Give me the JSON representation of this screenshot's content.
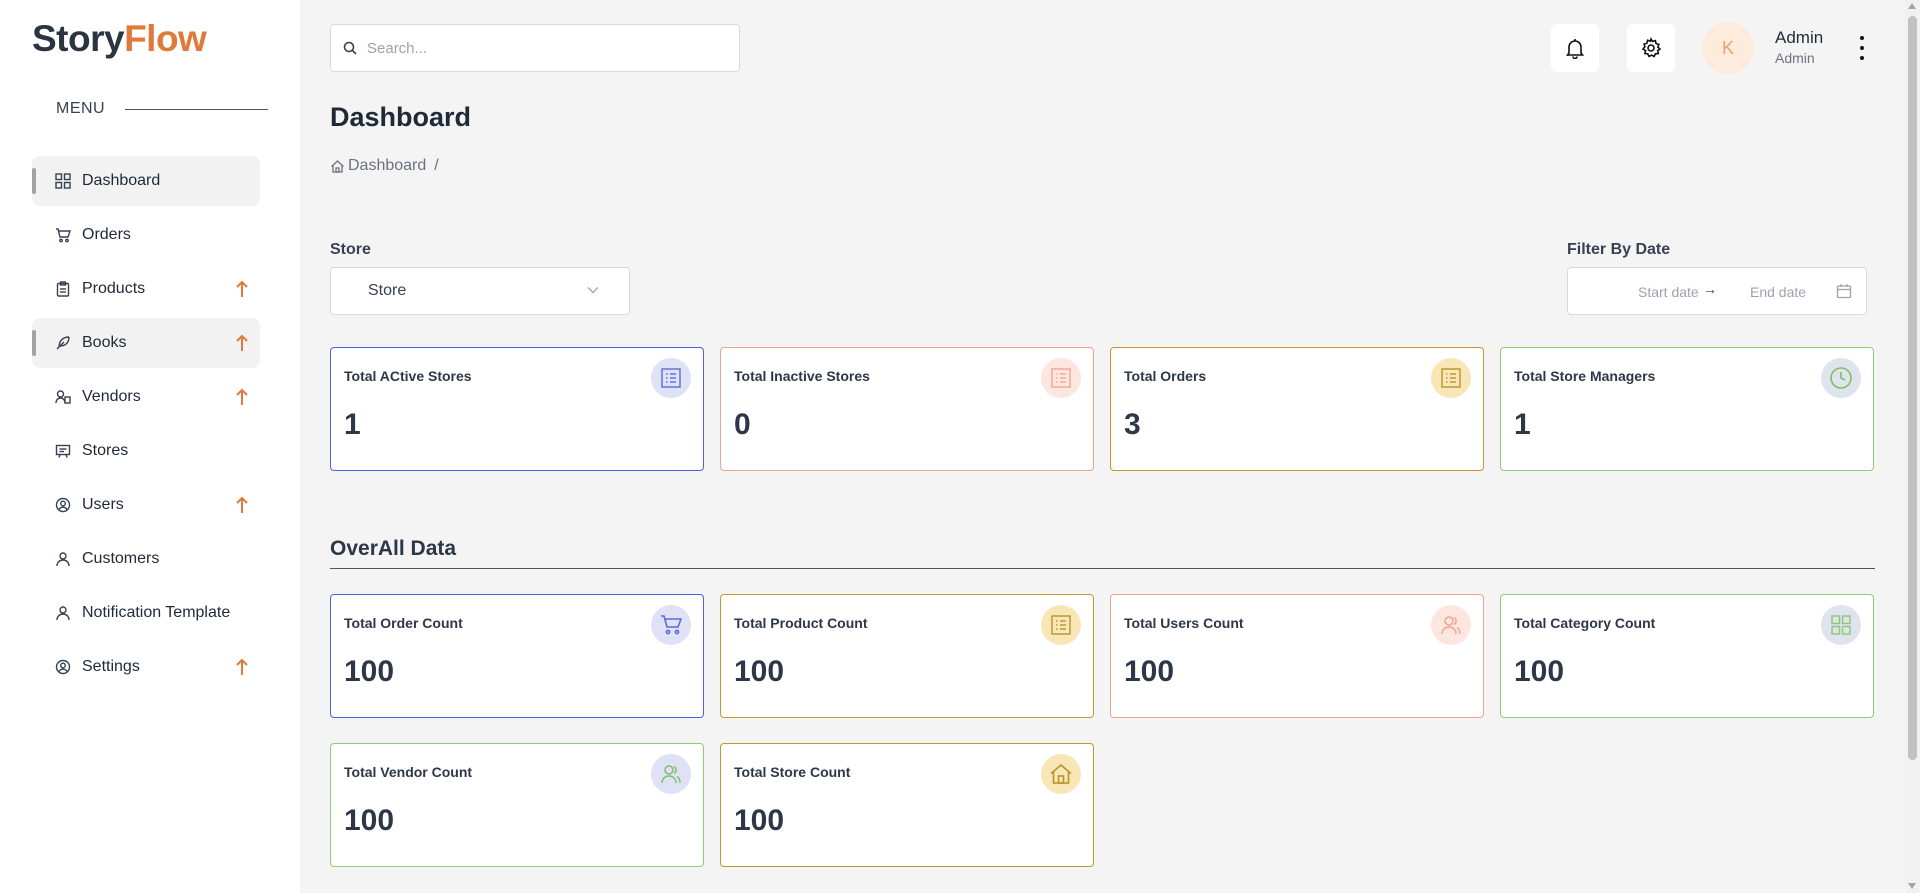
{
  "brand": {
    "part1": "Story",
    "part2": "Flow",
    "accent": "#e07a3a"
  },
  "search": {
    "placeholder": "Search..."
  },
  "user": {
    "avatar_initial": "K",
    "name": "Admin",
    "role": "Admin"
  },
  "menu": {
    "heading": "MENU"
  },
  "sidebar": {
    "items": [
      {
        "label": "Dashboard",
        "icon": "grid-icon",
        "active": true,
        "expandable": false
      },
      {
        "label": "Orders",
        "icon": "cart-icon",
        "active": false,
        "expandable": false
      },
      {
        "label": "Products",
        "icon": "clipboard-icon",
        "active": false,
        "expandable": true
      },
      {
        "label": "Books",
        "icon": "feather-icon",
        "active": true,
        "expandable": true
      },
      {
        "label": "Vendors",
        "icon": "vendors-icon",
        "active": false,
        "expandable": true
      },
      {
        "label": "Stores",
        "icon": "store-icon",
        "active": false,
        "expandable": false
      },
      {
        "label": "Users",
        "icon": "user-circle-icon",
        "active": false,
        "expandable": true
      },
      {
        "label": "Customers",
        "icon": "user-icon",
        "active": false,
        "expandable": false
      },
      {
        "label": "Notification Template",
        "icon": "user-icon",
        "active": false,
        "expandable": false
      },
      {
        "label": "Settings",
        "icon": "user-circle-icon",
        "active": false,
        "expandable": true
      }
    ]
  },
  "page": {
    "title": "Dashboard",
    "breadcrumb": "Dashboard",
    "breadcrumb_sep": "/"
  },
  "filters": {
    "store_label": "Store",
    "store_value": "Store",
    "date_label": "Filter By Date",
    "start_placeholder": "Start date",
    "end_placeholder": "End date",
    "arrow": "→"
  },
  "stats": [
    {
      "title": "Total ACtive Stores",
      "value": "1",
      "border": "#4f5fe0",
      "icon_bg": "#dfe2f7",
      "icon_color": "#5b6bd8",
      "icon": "list-icon"
    },
    {
      "title": "Total Inactive Stores",
      "value": "0",
      "border": "#f0a48c",
      "icon_bg": "#fde6e0",
      "icon_color": "#f2a48f",
      "icon": "list-icon"
    },
    {
      "title": "Total Orders",
      "value": "3",
      "border": "#c8952b",
      "icon_bg": "#f8e6b6",
      "icon_color": "#b8922a",
      "icon": "list-icon"
    },
    {
      "title": "Total Store Managers",
      "value": "1",
      "border": "#8ccf6e",
      "icon_bg": "#dfe3ee",
      "icon_color": "#7fbf66",
      "icon": "clock-icon"
    }
  ],
  "section": {
    "title": "OverAll Data"
  },
  "overall": [
    {
      "title": "Total Order Count",
      "value": "100",
      "border": "#4f5fe0",
      "icon_bg": "#dfe2f7",
      "icon_color": "#5b6bd8",
      "icon": "cart-icon"
    },
    {
      "title": "Total Product Count",
      "value": "100",
      "border": "#c8952b",
      "icon_bg": "#f8e6b6",
      "icon_color": "#b8922a",
      "icon": "list-icon"
    },
    {
      "title": "Total Users Count",
      "value": "100",
      "border": "#f0a48c",
      "icon_bg": "#fde6e0",
      "icon_color": "#f2a48f",
      "icon": "users-icon"
    },
    {
      "title": "Total Category Count",
      "value": "100",
      "border": "#8ccf6e",
      "icon_bg": "#dfe3ee",
      "icon_color": "#8fc975",
      "icon": "grid-icon"
    },
    {
      "title": "Total Vendor Count",
      "value": "100",
      "border": "#8ccf6e",
      "icon_bg": "#dfe2f7",
      "icon_color": "#7fbf66",
      "icon": "users-icon"
    },
    {
      "title": "Total Store Count",
      "value": "100",
      "border": "#c8952b",
      "icon_bg": "#f8e6b6",
      "icon_color": "#b8922a",
      "icon": "home-icon"
    }
  ]
}
